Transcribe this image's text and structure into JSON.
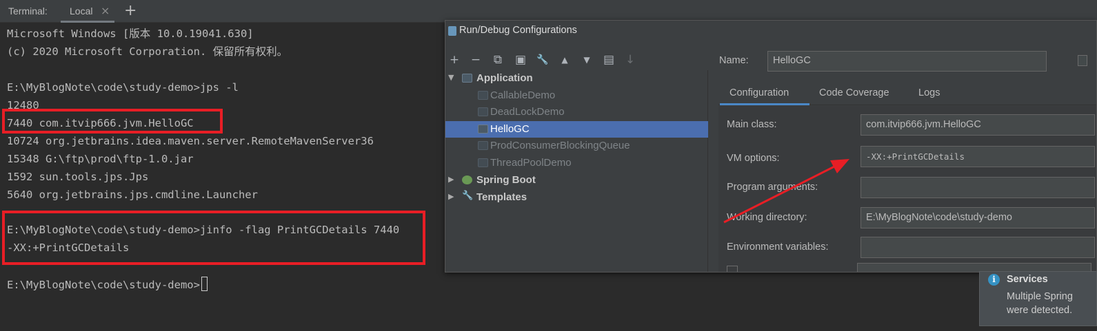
{
  "terminal": {
    "label": "Terminal:",
    "tab": "Local",
    "tab_close": "×",
    "add": "+",
    "lines": [
      "Microsoft Windows [版本 10.0.19041.630]",
      "(c) 2020 Microsoft Corporation. 保留所有权利。",
      "",
      "E:\\MyBlogNote\\code\\study-demo>jps -l",
      "12480",
      "7440 com.itvip666.jvm.HelloGC",
      "10724 org.jetbrains.idea.maven.server.RemoteMavenServer36",
      "15348 G:\\ftp\\prod\\ftp-1.0.jar",
      "1592 sun.tools.jps.Jps",
      "5640 org.jetbrains.jps.cmdline.Launcher",
      "",
      "E:\\MyBlogNote\\code\\study-demo>jinfo -flag PrintGCDetails 7440",
      "-XX:+PrintGCDetails",
      "",
      "E:\\MyBlogNote\\code\\study-demo>"
    ]
  },
  "dialog": {
    "title": "Run/Debug Configurations",
    "toolbar": {
      "add": "+",
      "remove": "−",
      "copy": "⧉",
      "save": "▣",
      "edit": "🔧",
      "up": "▲",
      "down": "▼",
      "folder": "▤",
      "sort": "↓"
    },
    "tree": {
      "application": "Application",
      "items": [
        "CallableDemo",
        "DeadLockDemo",
        "HelloGC",
        "ProdConsumerBlockingQueue",
        "ThreadPoolDemo"
      ],
      "selected": "HelloGC",
      "spring_boot": "Spring Boot",
      "templates": "Templates"
    },
    "name_label": "Name:",
    "name_value": "HelloGC",
    "tabs": [
      "Configuration",
      "Code Coverage",
      "Logs"
    ],
    "active_tab": "Configuration",
    "fields": {
      "main_class_label": "Main class:",
      "main_class_value": "com.itvip666.jvm.HelloGC",
      "vm_options_label": "VM options:",
      "vm_options_value": "-XX:+PrintGCDetails",
      "program_args_label": "Program arguments:",
      "program_args_value": "",
      "working_dir_label": "Working directory:",
      "working_dir_value": "E:\\MyBlogNote\\code\\study-demo",
      "env_vars_label": "Environment variables:",
      "env_vars_value": ""
    }
  },
  "notification": {
    "icon": "i",
    "title": "Services",
    "line1": "Multiple Spring",
    "line2": "were detected."
  },
  "colors": {
    "highlight": "#e81e25",
    "selection": "#4b6eaf",
    "background": "#2b2b2b"
  }
}
